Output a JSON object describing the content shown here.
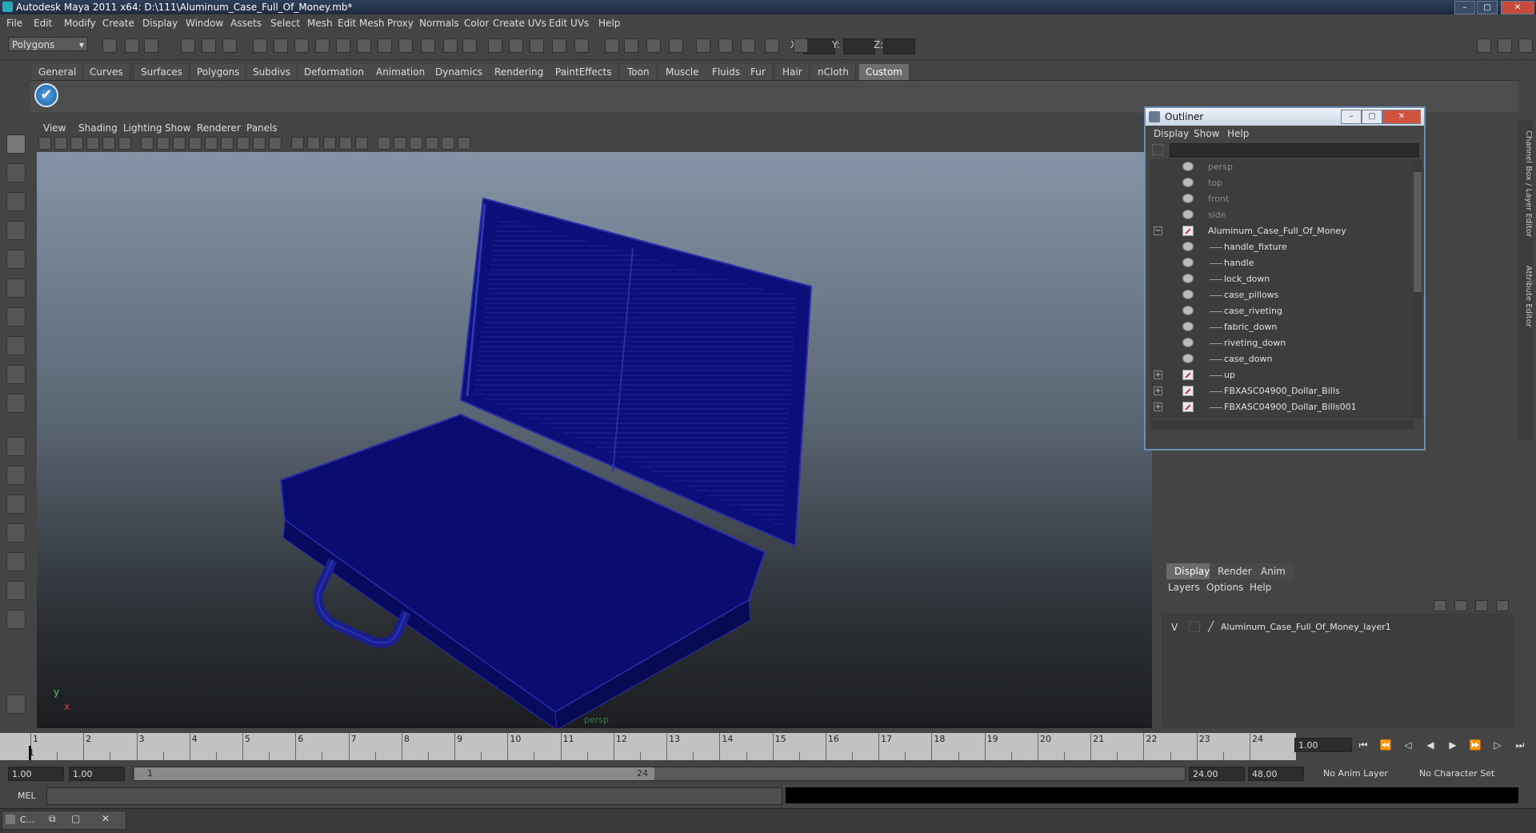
{
  "window": {
    "title": "Autodesk Maya 2011 x64: D:\\111\\Aluminum_Case_Full_Of_Money.mb*"
  },
  "menu": [
    "File",
    "Edit",
    "Modify",
    "Create",
    "Display",
    "Window",
    "Assets",
    "Select",
    "Mesh",
    "Edit Mesh",
    "Proxy",
    "Normals",
    "Color",
    "Create UVs",
    "Edit UVs",
    "Help"
  ],
  "status": {
    "mode": "Polygons",
    "x_label": "X:",
    "y_label": "Y:",
    "z_label": "Z:"
  },
  "shelf_tabs": [
    "General",
    "Curves",
    "Surfaces",
    "Polygons",
    "Subdivs",
    "Deformation",
    "Animation",
    "Dynamics",
    "Rendering",
    "PaintEffects",
    "Toon",
    "Muscle",
    "Fluids",
    "Fur",
    "Hair",
    "nCloth",
    "Custom"
  ],
  "shelf_active": "Custom",
  "panel_menu": [
    "View",
    "Shading",
    "Lighting",
    "Show",
    "Renderer",
    "Panels"
  ],
  "viewport": {
    "camera_label": "persp",
    "axis_y": "y",
    "axis_x": "x"
  },
  "outliner": {
    "title": "Outliner",
    "menu": [
      "Display",
      "Show",
      "Help"
    ],
    "items": [
      {
        "label": "persp",
        "kind": "camera",
        "dim": true
      },
      {
        "label": "top",
        "kind": "camera",
        "dim": true
      },
      {
        "label": "front",
        "kind": "camera",
        "dim": true
      },
      {
        "label": "side",
        "kind": "camera",
        "dim": true
      },
      {
        "label": "Aluminum_Case_Full_Of_Money",
        "kind": "group",
        "expand": "−"
      },
      {
        "label": "handle_fixture",
        "kind": "mesh"
      },
      {
        "label": "handle",
        "kind": "mesh"
      },
      {
        "label": "lock_down",
        "kind": "mesh"
      },
      {
        "label": "case_pillows",
        "kind": "mesh"
      },
      {
        "label": "case_riveting",
        "kind": "mesh"
      },
      {
        "label": "fabric_down",
        "kind": "mesh"
      },
      {
        "label": "riveting_down",
        "kind": "mesh"
      },
      {
        "label": "case_down",
        "kind": "mesh"
      },
      {
        "label": "up",
        "kind": "group",
        "expand": "+"
      },
      {
        "label": "FBXASC04900_Dollar_Bills",
        "kind": "group",
        "expand": "+"
      },
      {
        "label": "FBXASC04900_Dollar_Bills001",
        "kind": "group",
        "expand": "+"
      }
    ]
  },
  "side_tabs": [
    "Channel Box / Layer Editor",
    "Attribute Editor"
  ],
  "layers": {
    "tabs": [
      "Display",
      "Render",
      "Anim"
    ],
    "active": "Display",
    "menu": [
      "Layers",
      "Options",
      "Help"
    ],
    "row": {
      "visibility": "V",
      "name": "Aluminum_Case_Full_Of_Money_layer1"
    }
  },
  "timeline": {
    "start": 1,
    "end": 24,
    "current": "1.00",
    "marker": "1"
  },
  "range": {
    "start": "1.00",
    "inner_start": "1.00",
    "handle_start": "1",
    "handle_end": "24",
    "inner_end": "24.00",
    "end": "48.00",
    "anim_layer": "No Anim Layer",
    "char_set": "No Character Set"
  },
  "command": {
    "label": "MEL"
  },
  "taskbar": {
    "item": "C..."
  },
  "colors": {
    "wire": "#0c0f7a",
    "accent": "#6d6d6d"
  }
}
